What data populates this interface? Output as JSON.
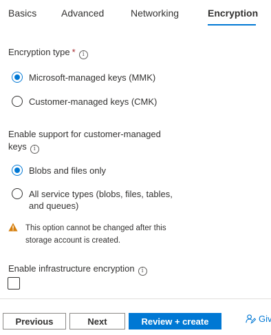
{
  "tabs": [
    {
      "label": "Basics"
    },
    {
      "label": "Advanced"
    },
    {
      "label": "Networking"
    },
    {
      "label": "Encryption",
      "active": true
    }
  ],
  "encryption_type": {
    "label": "Encryption type",
    "required_marker": "*",
    "options": [
      {
        "label": "Microsoft-managed keys (MMK)",
        "checked": true
      },
      {
        "label": "Customer-managed keys (CMK)",
        "checked": false
      }
    ]
  },
  "cmk_support": {
    "label_line1": "Enable support for customer-managed",
    "label_line2": "keys",
    "options": [
      {
        "label": "Blobs and files only",
        "checked": true
      },
      {
        "label_line1": "All service types (blobs, files, tables,",
        "label_line2": "and queues)",
        "checked": false
      }
    ],
    "warning_line1": "This option cannot be changed after this",
    "warning_line2": "storage account is created."
  },
  "infrastructure": {
    "label": "Enable infrastructure encryption",
    "checked": false
  },
  "footer": {
    "previous_label": "Previous",
    "next_label": "Next",
    "review_label": "Review + create",
    "feedback_label": "Giv"
  },
  "colors": {
    "accent": "#0078d4",
    "warning": "#d67f0d",
    "required": "#a4262c"
  },
  "icons": {
    "info": "info-icon",
    "warning": "warning-icon",
    "feedback": "feedback-icon"
  }
}
